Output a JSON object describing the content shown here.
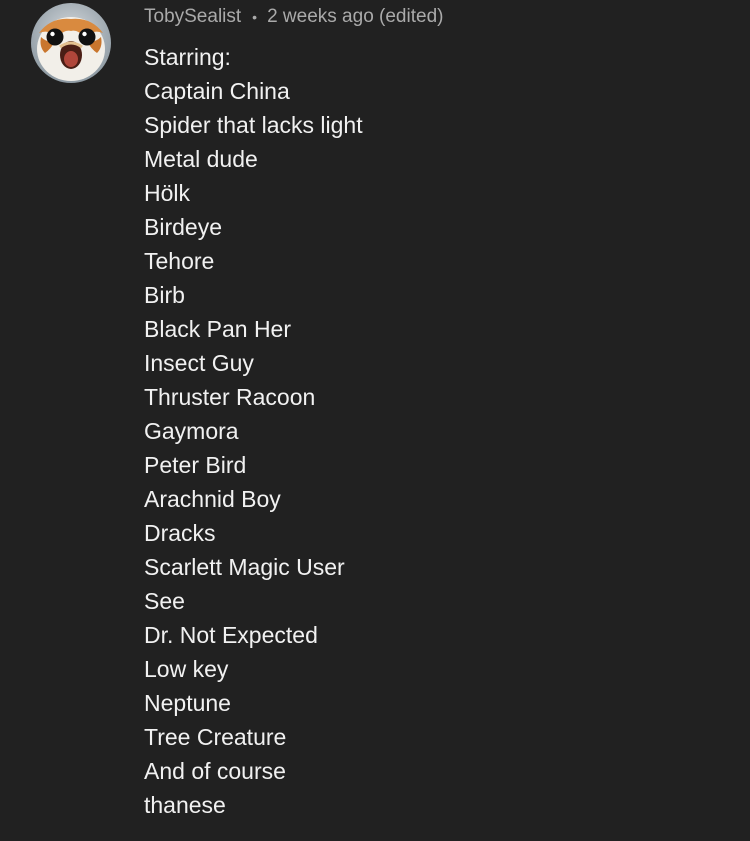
{
  "comment": {
    "author": "TobySealist",
    "separator": "•",
    "timestamp": "2 weeks ago (edited)",
    "avatar_icon": "porg-avatar-icon",
    "lines": [
      "Starring:",
      "Captain China",
      "Spider that lacks light",
      "Metal dude",
      "Hölk",
      "Birdeye",
      "Tehore",
      "Birb",
      "Black Pan Her",
      "Insect Guy",
      "Thruster Racoon",
      "Gaymora",
      "Peter Bird",
      "Arachnid Boy",
      "Dracks",
      "Scarlett Magic User",
      "See",
      "Dr. Not Expected",
      "Low key",
      "Neptune",
      "Tree Creature",
      "And of course",
      "thanese"
    ]
  },
  "colors": {
    "background": "#212121",
    "text_primary": "#f1f1f1",
    "text_secondary": "#aaaaaa"
  }
}
